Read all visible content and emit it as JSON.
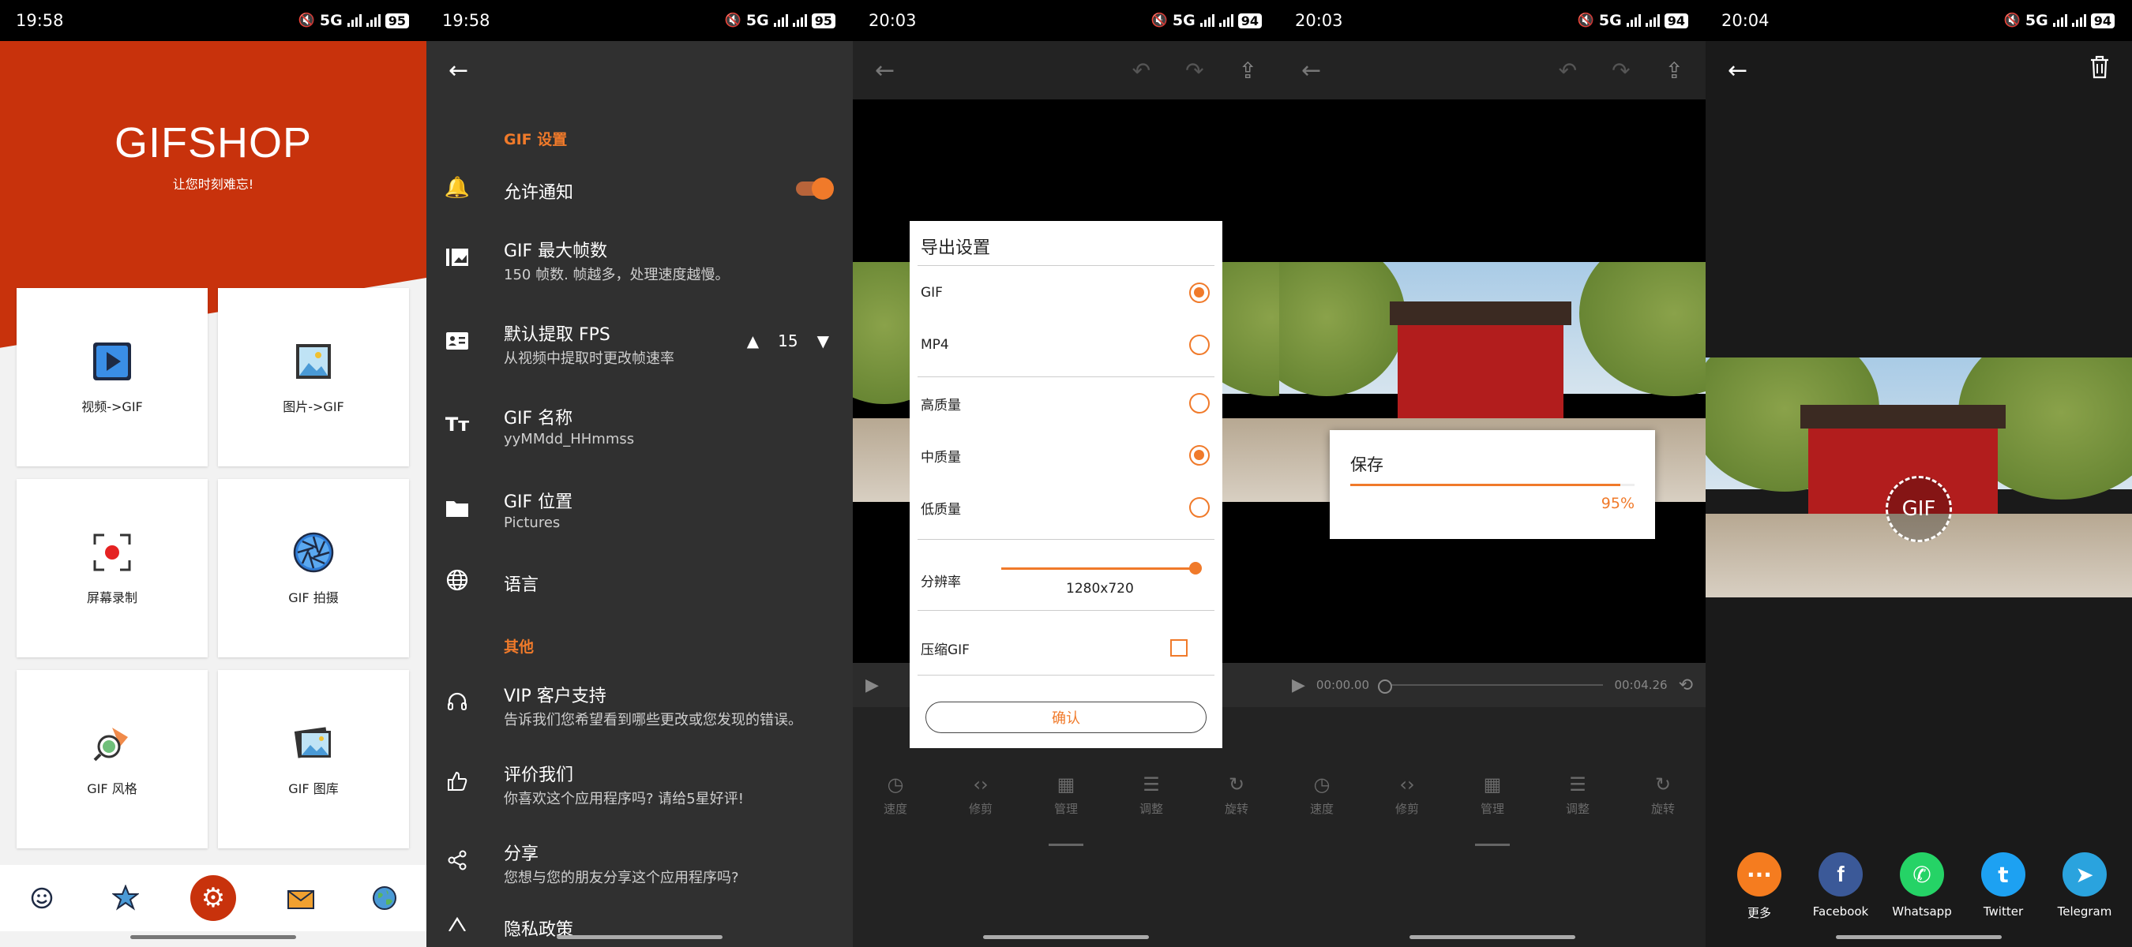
{
  "screens": [
    {
      "status": {
        "time": "19:58",
        "network": "5G",
        "battery": "95"
      },
      "app_title": "GIFSHOP",
      "tagline": "让您时刻难忘!",
      "tiles": [
        {
          "label": "视频->GIF",
          "icon": "video-play-icon"
        },
        {
          "label": "图片->GIF",
          "icon": "image-icon"
        },
        {
          "label": "屏幕录制",
          "icon": "screen-record-icon"
        },
        {
          "label": "GIF 拍摄",
          "icon": "camera-aperture-icon"
        },
        {
          "label": "GIF 风格",
          "icon": "palette-search-icon"
        },
        {
          "label": "GIF 图库",
          "icon": "gallery-icon"
        }
      ],
      "bottom_nav": [
        "smile-icon",
        "star-badge-icon",
        "gear-icon",
        "mail-icon",
        "globe-icon"
      ]
    },
    {
      "status": {
        "time": "19:58",
        "network": "5G",
        "battery": "95"
      },
      "section_gif": "GIF 设置",
      "section_other": "其他",
      "rows": [
        {
          "title": "允许通知",
          "subtitle": ""
        },
        {
          "title": "GIF 最大帧数",
          "subtitle": "150 帧数. 帧越多，处理速度越慢。"
        },
        {
          "title": "默认提取 FPS",
          "subtitle": "从视频中提取时更改帧速率"
        },
        {
          "title": "GIF 名称",
          "subtitle": "yyMMdd_HHmmss"
        },
        {
          "title": "GIF 位置",
          "subtitle": "Pictures"
        },
        {
          "title": "语言",
          "subtitle": ""
        },
        {
          "title": "VIP 客户支持",
          "subtitle": "告诉我们您希望看到哪些更改或您发现的错误。"
        },
        {
          "title": "评价我们",
          "subtitle": "你喜欢这个应用程序吗? 请给5星好评!"
        },
        {
          "title": "分享",
          "subtitle": "您想与您的朋友分享这个应用程序吗?"
        },
        {
          "title": "隐私政策",
          "subtitle": ""
        }
      ],
      "fps_value": "15"
    },
    {
      "status": {
        "time": "20:03",
        "network": "5G",
        "battery": "94"
      },
      "dialog": {
        "title": "导出设置",
        "formats": [
          "GIF",
          "MP4"
        ],
        "selected_format": "GIF",
        "qualities": [
          "高质量",
          "中质量",
          "低质量"
        ],
        "selected_quality": "中质量",
        "resolution_label": "分辨率",
        "resolution_value": "1280x720",
        "compress_label": "压缩GIF",
        "compress_checked": false,
        "confirm_label": "确认"
      },
      "tools": [
        "速度",
        "修剪",
        "管理",
        "调整",
        "旋转"
      ]
    },
    {
      "status": {
        "time": "20:03",
        "network": "5G",
        "battery": "94"
      },
      "save": {
        "title": "保存",
        "progress_percent": 95,
        "progress_label": "95%"
      },
      "player": {
        "current": "00:00.00",
        "total": "00:04.26"
      },
      "tools": [
        "速度",
        "修剪",
        "管理",
        "调整",
        "旋转"
      ]
    },
    {
      "status": {
        "time": "20:04",
        "network": "5G",
        "battery": "94"
      },
      "badge": "GIF",
      "share_targets": [
        {
          "label": "更多",
          "color": "#f57c1f",
          "glyph": "···"
        },
        {
          "label": "Facebook",
          "color": "#3b5998",
          "glyph": "f"
        },
        {
          "label": "Whatsapp",
          "color": "#25d366",
          "glyph": "✆"
        },
        {
          "label": "Twitter",
          "color": "#1da1f2",
          "glyph": "t"
        },
        {
          "label": "Telegram",
          "color": "#2aa3de",
          "glyph": "➤"
        }
      ]
    }
  ],
  "colors": {
    "accent": "#f07a2a",
    "brand_red": "#c8320c"
  }
}
